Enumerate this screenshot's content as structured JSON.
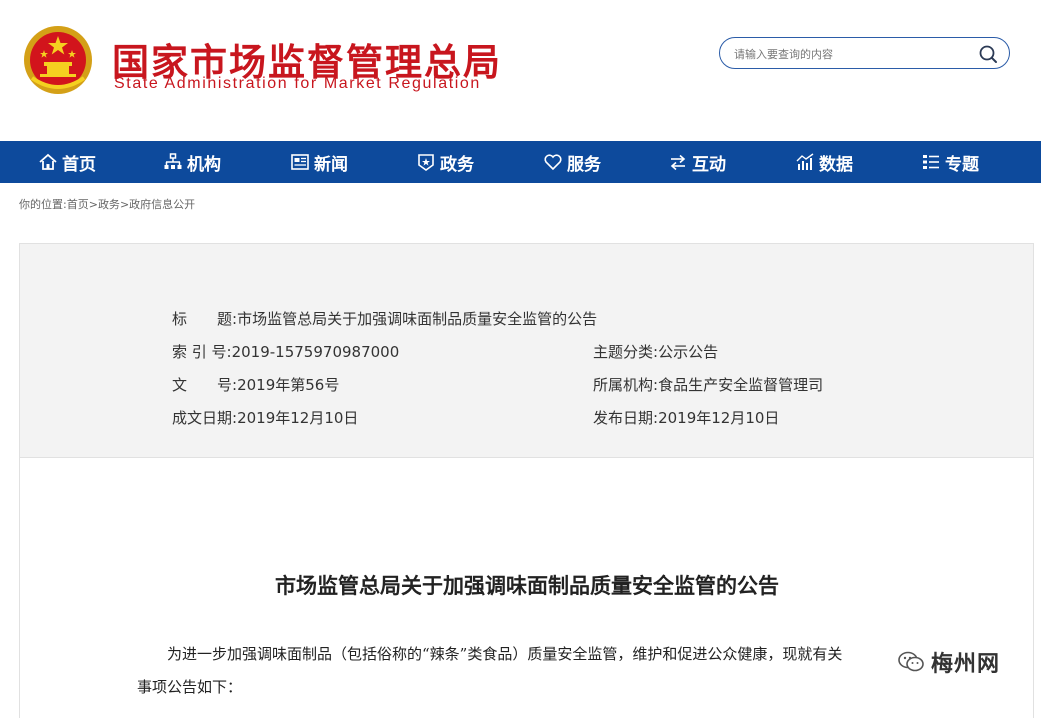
{
  "header": {
    "title_cn": "国家市场监督管理总局",
    "title_en": "State Administration for Market Regulation",
    "search_placeholder": "请输入要查询的内容"
  },
  "nav": [
    {
      "label": "首页",
      "icon": "home-icon"
    },
    {
      "label": "机构",
      "icon": "org-icon"
    },
    {
      "label": "新闻",
      "icon": "news-icon"
    },
    {
      "label": "政务",
      "icon": "affairs-icon"
    },
    {
      "label": "服务",
      "icon": "heart-icon"
    },
    {
      "label": "互动",
      "icon": "interact-icon"
    },
    {
      "label": "数据",
      "icon": "chart-icon"
    },
    {
      "label": "专题",
      "icon": "topic-icon"
    }
  ],
  "breadcrumb": {
    "prefix": "你的位置:",
    "items": [
      "首页",
      "政务",
      "政府信息公开"
    ],
    "separator": ">"
  },
  "info": {
    "title_label": "标　　题:",
    "title_value": "市场监管总局关于加强调味面制品质量安全监管的公告",
    "index_label": "索 引 号:",
    "index_value": "2019-1575970987000",
    "category_label": "主题分类:",
    "category_value": "公示公告",
    "doc_no_label": "文　　号:",
    "doc_no_value": "2019年第56号",
    "agency_label": "所属机构:",
    "agency_value": "食品生产安全监督管理司",
    "created_label": "成文日期:",
    "created_value": "2019年12月10日",
    "published_label": "发布日期:",
    "published_value": "2019年12月10日"
  },
  "article": {
    "title": "市场监管总局关于加强调味面制品质量安全监管的公告",
    "para1": "为进一步加强调味面制品（包括俗称的“辣条”类食品）质量安全监管，维护和促进公众健康，现就有关",
    "para2": "事项公告如下："
  },
  "watermark": {
    "text": "梅州网"
  },
  "colors": {
    "brand_red": "#c8161e",
    "nav_blue": "#0d4a9c",
    "info_bg": "#f3f3f3"
  }
}
